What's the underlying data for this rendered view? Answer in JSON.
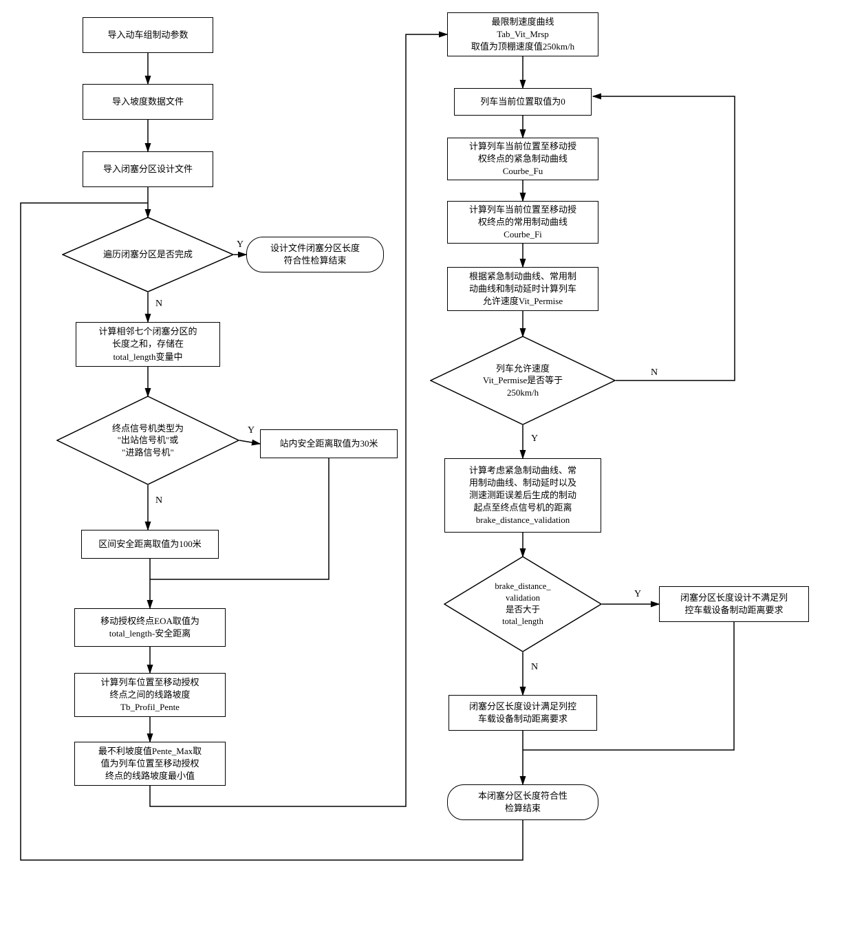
{
  "nodes": {
    "n1": "导入动车组制动参数",
    "n2": "导入坡度数据文件",
    "n3": "导入闭塞分区设计文件",
    "d1": "遍历闭塞分区是否完成",
    "t1": "设计文件闭塞分区长度\n符合性检算结束",
    "n4": "计算相邻七个闭塞分区的\n长度之和，存储在\ntotal_length变量中",
    "d2": "终点信号机类型为\n\"出站信号机\"或\n\"进路信号机\"",
    "n5": "站内安全距离取值为30米",
    "n6": "区间安全距离取值为100米",
    "n7": "移动授权终点EOA取值为\ntotal_length-安全距离",
    "n8": "计算列车位置至移动授权\n终点之间的线路坡度\nTb_Profil_Pente",
    "n9": "最不利坡度值Pente_Max取\n值为列车位置至移动授权\n终点的线路坡度最小值",
    "r1": "最限制速度曲线\nTab_Vit_Mrsp\n取值为顶棚速度值250km/h",
    "r2": "列车当前位置取值为0",
    "r3": "计算列车当前位置至移动授\n权终点的紧急制动曲线\nCourbe_Fu",
    "r4": "计算列车当前位置至移动授\n权终点的常用制动曲线\nCourbe_Fi",
    "r5": "根据紧急制动曲线、常用制\n动曲线和制动延时计算列车\n允许速度Vit_Permise",
    "d3": "列车允许速度\nVit_Permise是否等于\n250km/h",
    "r6": "计算考虑紧急制动曲线、常\n用制动曲线、制动延时以及\n测速测距误差后生成的制动\n起点至终点信号机的距离\nbrake_distance_validation",
    "d4": "brake_distance_\nvalidation\n是否大于\ntotal_length",
    "r7": "闭塞分区长度设计不满足列\n控车载设备制动距离要求",
    "r8": "闭塞分区长度设计满足列控\n车载设备制动距离要求",
    "t2": "本闭塞分区长度符合性\n检算结束"
  },
  "labels": {
    "Y": "Y",
    "N": "N"
  }
}
